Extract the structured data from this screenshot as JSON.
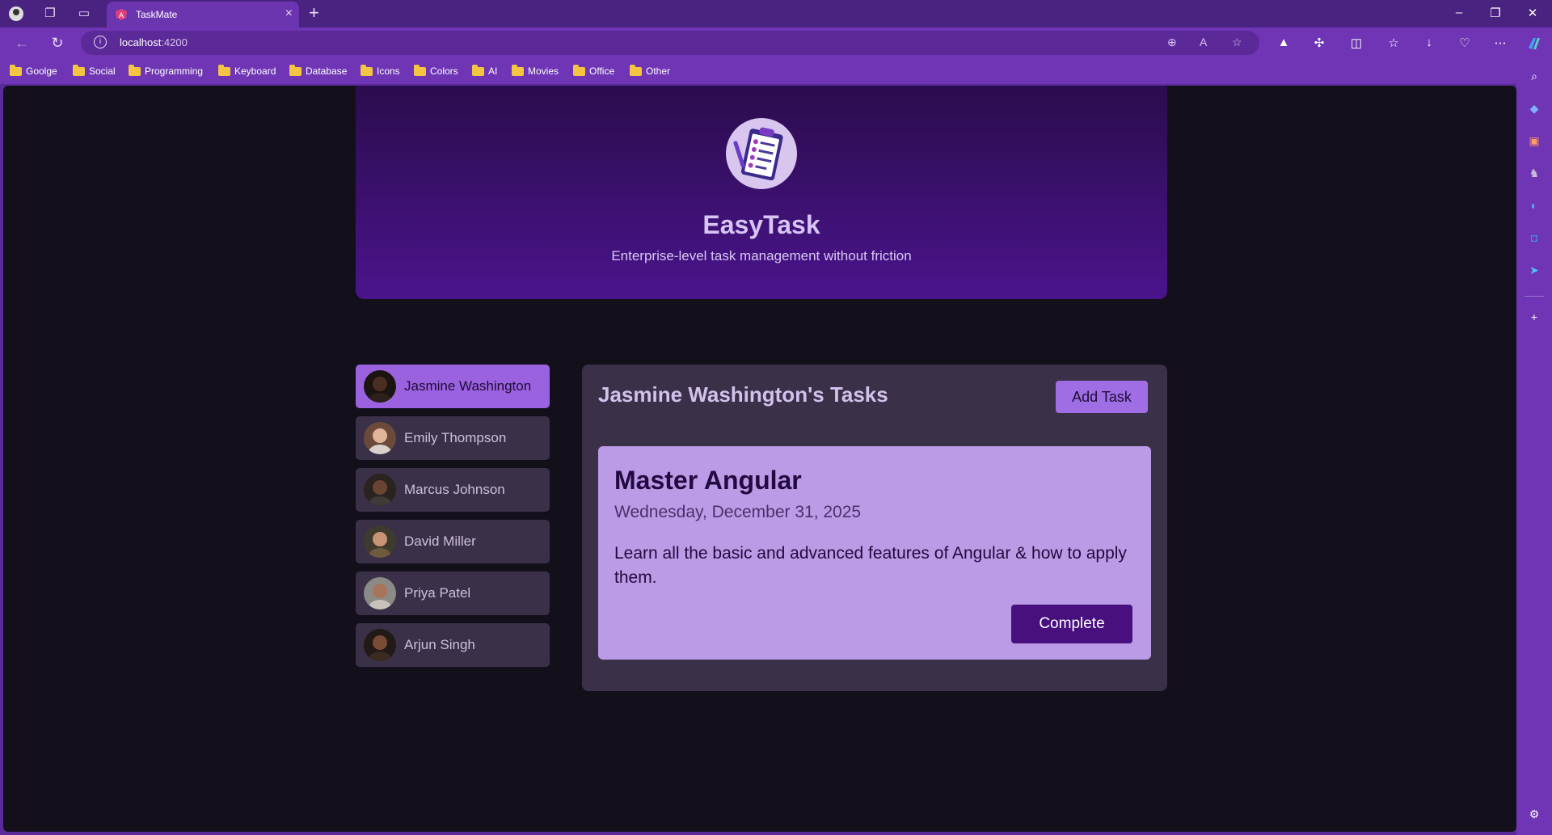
{
  "browser": {
    "tab_title": "TaskMate",
    "url_host": "localhost",
    "url_port": ":4200",
    "bookmarks": [
      "Goolge",
      "Social",
      "Programming",
      "Keyboard",
      "Database",
      "Icons",
      "Colors",
      "AI",
      "Movies",
      "Office",
      "Other"
    ]
  },
  "app": {
    "title": "EasyTask",
    "subtitle": "Enterprise-level task management without friction"
  },
  "users": [
    {
      "name": "Jasmine Washington",
      "active": true
    },
    {
      "name": "Emily Thompson",
      "active": false
    },
    {
      "name": "Marcus Johnson",
      "active": false
    },
    {
      "name": "David Miller",
      "active": false
    },
    {
      "name": "Priya Patel",
      "active": false
    },
    {
      "name": "Arjun Singh",
      "active": false
    }
  ],
  "tasks": {
    "heading": "Jasmine Washington's Tasks",
    "add_label": "Add Task",
    "card": {
      "title": "Master Angular",
      "date": "Wednesday, December 31, 2025",
      "description": "Learn all the basic and advanced features of Angular & how to apply them.",
      "complete_label": "Complete"
    }
  },
  "colors": {
    "accent": "#9b62df",
    "header_start": "#2b0c4d",
    "header_end": "#4a148c",
    "card": "#bb9be6",
    "button_dark": "#48107f"
  }
}
